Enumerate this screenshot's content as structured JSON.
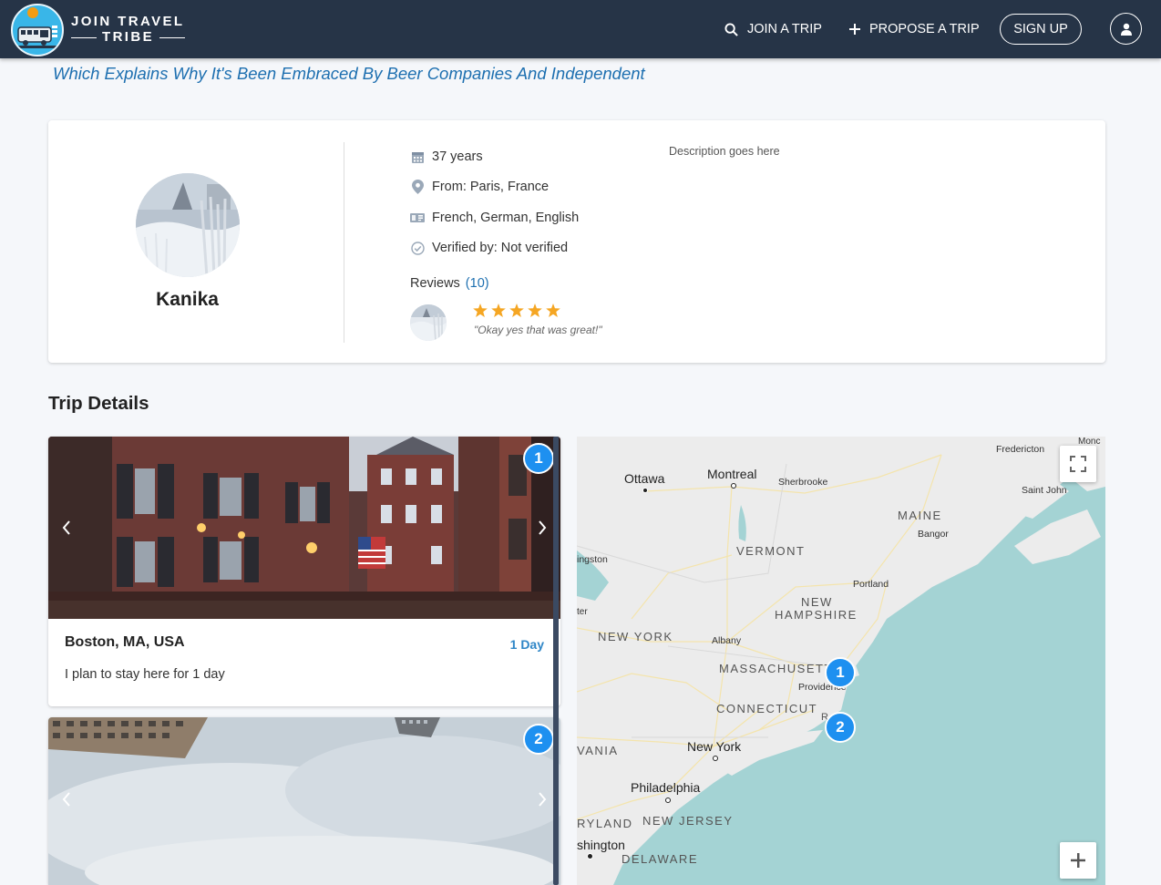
{
  "navbar": {
    "logo_line1": "JOIN TRAVEL",
    "logo_line2": "TRIBE",
    "join_trip": "JOIN A TRIP",
    "propose_trip": "PROPOSE A TRIP",
    "sign_up": "SIGN UP",
    "bg_color": "#263447"
  },
  "banner": {
    "text": "Which Explains Why It's Been Embraced By Beer Companies And Independent"
  },
  "profile": {
    "name": "Kanika",
    "age": "37 years",
    "from": "From: Paris, France",
    "languages": "French, German, English",
    "verified": "Verified by: Not verified",
    "description": "Description goes here",
    "reviews_label": "Reviews",
    "reviews_count": "(10)",
    "review": {
      "stars": 5,
      "quote": "\"Okay yes that was great!\""
    }
  },
  "trip_details": {
    "title": "Trip Details",
    "trips": [
      {
        "index": "1",
        "place": "Boston, MA, USA",
        "duration": "1 Day",
        "description": "I plan to stay here for 1 day"
      },
      {
        "index": "2"
      }
    ]
  },
  "map": {
    "labels": {
      "ottawa": "Ottawa",
      "montreal": "Montreal",
      "sherbrooke": "Sherbrooke",
      "fredericton": "Fredericton",
      "moncton": "Monc",
      "saint_john": "Saint John",
      "maine": "MAINE",
      "bangor": "Bangor",
      "vermont": "VERMONT",
      "kingston": "ingston",
      "portland": "Portland",
      "new_hampshire_1": "NEW",
      "new_hampshire_2": "HAMPSHIRE",
      "ter": "ter",
      "new_york_state": "NEW YORK",
      "albany": "Albany",
      "massachusetts": "MASSACHUSETT",
      "providence": "Providence",
      "connecticut": "CONNECTICUT",
      "ri": "R",
      "pennsylvania": "VANIA",
      "new_york_city": "New York",
      "philadelphia": "Philadelphia",
      "maryland": "RYLAND",
      "new_jersey": "NEW JERSEY",
      "washington": "shington",
      "delaware": "DELAWARE"
    },
    "markers": [
      "1",
      "2"
    ],
    "water_color": "#a4d3d4",
    "land_color": "#ececec"
  },
  "colors": {
    "accent": "#1d6fb0",
    "badge": "#1e90f0",
    "star": "#f5a623"
  }
}
